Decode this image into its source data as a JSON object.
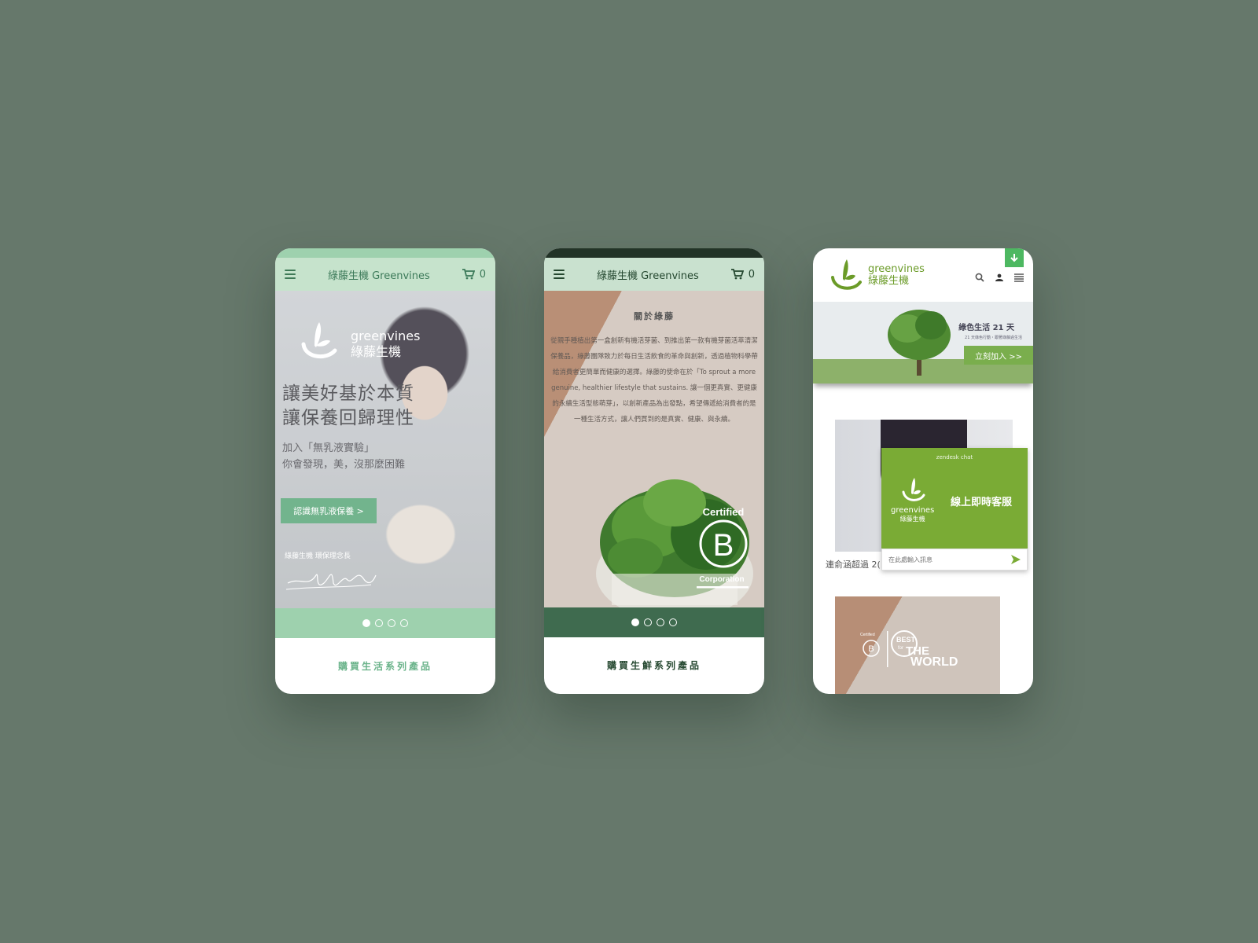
{
  "phone1": {
    "header": {
      "brand": "綠藤生機 Greenvines",
      "cart_count": "0"
    },
    "hero": {
      "logo_text_en": "greenvines",
      "logo_text_zh": "綠藤生機",
      "slogan_line1": "讓美好基於本質",
      "slogan_line2": "讓保養回歸理性",
      "sub_line1": "加入「無乳液實驗」",
      "sub_line2": "你會發現，美，沒那麼困難",
      "cta": "認識無乳液保養 >",
      "caption": "綠藤生機 環保理念長"
    },
    "carousel": {
      "total": 4,
      "active": 0
    },
    "footer_cta": "購買生活系列產品"
  },
  "phone2": {
    "header": {
      "brand": "綠藤生機 Greenvines",
      "cart_count": "0"
    },
    "about": {
      "title": "關於綠藤",
      "body": "從親手種植出第一盒創新有機活芽菌、到推出第一款有機芽菌活萃清潔保養品，綠藤團隊致力於每日生活飲食的革命與創新，透過植物科學帶給消費者更簡單而健康的選擇。綠藤的使命在於「To sprout a more genuine, healthier lifestyle that sustains. 讓一個更真實、更健康的永續生活型態萌芽」，以創新產品為出發點，希望傳遞給消費者的是一種生活方式，讓人們買到的是真實、健康、與永續。"
    },
    "badge": {
      "line1": "Certified",
      "letter": "B",
      "line2": "Corporation"
    },
    "carousel": {
      "total": 4,
      "active": 0
    },
    "footer_cta": "購買生鮮系列產品"
  },
  "phone3": {
    "header": {
      "logo_en": "greenvines",
      "logo_zh": "綠藤生機"
    },
    "banner": {
      "title": "綠色生活 21 天",
      "subtitle": "21 天綠色行動・跟著綠藤過生活",
      "cta": "立刻加入 >>"
    },
    "caption": "連俞涵超過 2(",
    "chat": {
      "header": "zendesk chat",
      "brand_en": "greenvines",
      "brand_zh": "綠藤生機",
      "title": "線上即時客服",
      "placeholder": "在此處輸入訊息"
    },
    "award": {
      "certified": "Certified",
      "best": "BEST",
      "for": "for",
      "the": "THE",
      "world": "WORLD"
    }
  },
  "colors": {
    "background": "#66786b",
    "mint": "#9ed1ae",
    "green_dark": "#3f6b4f",
    "chat_green": "#7aab35",
    "download_green": "#4db861"
  },
  "icons": [
    "menu-icon",
    "cart-icon",
    "search-icon",
    "user-icon",
    "download-arrow-icon",
    "send-icon",
    "greenvines-logo-icon"
  ]
}
